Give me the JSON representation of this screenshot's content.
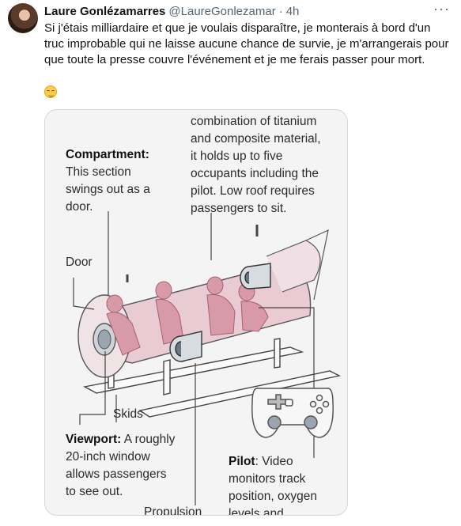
{
  "author": {
    "name": "Laure Gonlézamarres",
    "handle": "@LaureGonlezamar",
    "separator": "·",
    "time": "4h"
  },
  "more_label": "···",
  "tweet_text": "Si j'étais milliardaire et que je voulais disparaître, je monterais à bord d'un truc improbable qui ne laisse aucune chance de survie, je m'arrangerais pour que toute la presse couvre l'événement et je me ferais passer pour mort.",
  "emoji": "smirking-face",
  "infographic": {
    "hull_desc": "combination of titanium and composite material, it holds up to five occupants including the pilot. Low roof requires passengers to sit.",
    "hull_lines": [
      "combination of titanium",
      "and composite material,",
      "it holds up to five",
      "occupants including the",
      "pilot. Low roof requires",
      "passengers to sit."
    ],
    "compartment_title": "Compartment:",
    "compartment_lines": [
      "This section",
      "swings out as a",
      "door."
    ],
    "door_label": "Door",
    "skids_label": "Skids",
    "viewport_title": "Viewport:",
    "viewport_lines": [
      " A roughly",
      "20-inch window",
      "allows passengers",
      "to see out."
    ],
    "pilot_title": "Pilot",
    "pilot_lines": [
      ": Video",
      "monitors track",
      "position, oxygen",
      "levels and"
    ],
    "propulsion_label": "Propulsion"
  },
  "colors": {
    "text": "#0f1419",
    "muted": "#536471",
    "border": "#cfd9de",
    "hull_fill": "#e8c9d2",
    "occupants": "#d9a0ad"
  }
}
